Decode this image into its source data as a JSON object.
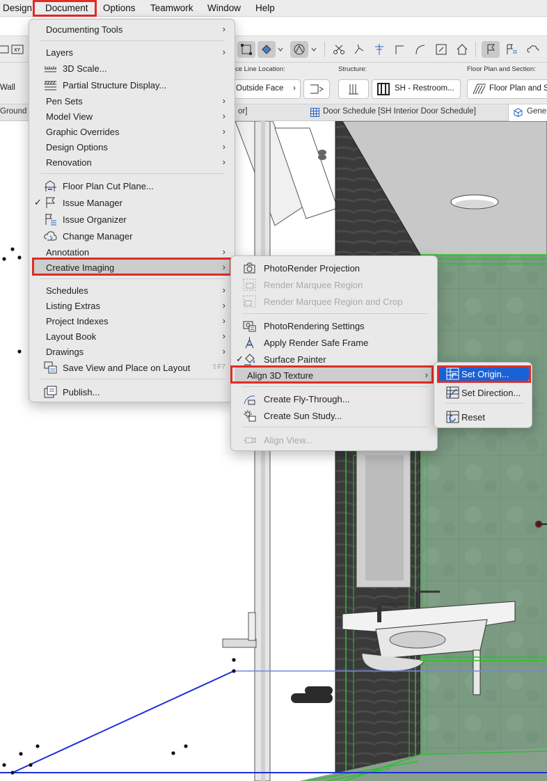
{
  "menubar": {
    "items": [
      "Design",
      "Document",
      "Options",
      "Teamwork",
      "Window",
      "Help"
    ],
    "highlight_color": "#e02c25"
  },
  "infobox": {
    "ref_line_label": "ce Line Location:",
    "ref_line_value": "Outside Face",
    "structure_label": "Structure:",
    "structure_value": "SH - Restroom...",
    "floorplan_label": "Floor Plan and Section:",
    "floorplan_value": "Floor Plan and S",
    "wall_value": "Wall"
  },
  "tabs": {
    "ground": "Ground",
    "partial": "or]",
    "door_schedule": "Door Schedule [SH Interior Door Schedule]",
    "generic": "Gener"
  },
  "document_menu": {
    "items": [
      {
        "label": "Documenting Tools",
        "submenu": true
      },
      {
        "label": "Layers",
        "submenu": true
      },
      {
        "label": "3D Scale...",
        "icon": "3d-scale-icon"
      },
      {
        "label": "Partial Structure Display...",
        "icon": "partial-structure-icon"
      },
      {
        "label": "Pen Sets",
        "submenu": true
      },
      {
        "label": "Model View",
        "submenu": true
      },
      {
        "label": "Graphic Overrides",
        "submenu": true
      },
      {
        "label": "Design Options",
        "submenu": true
      },
      {
        "label": "Renovation",
        "submenu": true
      },
      {
        "label": "Floor Plan Cut Plane...",
        "icon": "cut-plane-icon"
      },
      {
        "label": "Issue Manager",
        "icon": "flag-icon",
        "checked": true
      },
      {
        "label": "Issue Organizer",
        "icon": "issue-organizer-icon"
      },
      {
        "label": "Change Manager",
        "icon": "change-manager-icon"
      },
      {
        "label": "Annotation",
        "submenu": true
      },
      {
        "label": "Creative Imaging",
        "submenu": true,
        "highlighted": true
      },
      {
        "label": "Schedules",
        "submenu": true
      },
      {
        "label": "Listing Extras",
        "submenu": true
      },
      {
        "label": "Project Indexes",
        "submenu": true
      },
      {
        "label": "Layout Book",
        "submenu": true
      },
      {
        "label": "Drawings",
        "submenu": true
      },
      {
        "label": "Save View and Place on Layout",
        "icon": "save-view-icon",
        "shortcut": "⇧F7"
      },
      {
        "label": "Publish...",
        "icon": "publish-icon"
      }
    ]
  },
  "creative_imaging_menu": {
    "items": [
      {
        "label": "PhotoRender Projection",
        "icon": "camera-icon"
      },
      {
        "label": "Render Marquee Region",
        "icon": "marquee-camera-icon",
        "disabled": true
      },
      {
        "label": "Render Marquee Region and Crop",
        "icon": "marquee-crop-icon",
        "disabled": true
      },
      {
        "label": "PhotoRendering Settings",
        "icon": "render-settings-icon"
      },
      {
        "label": "Apply Render Safe Frame",
        "icon": "safe-frame-icon"
      },
      {
        "label": "Surface Painter",
        "icon": "paint-bucket-icon",
        "checked": true
      },
      {
        "label": "Align 3D Texture",
        "submenu": true,
        "highlighted": true
      },
      {
        "label": "Create Fly-Through...",
        "icon": "fly-through-icon"
      },
      {
        "label": "Create Sun Study...",
        "icon": "sun-study-icon"
      },
      {
        "label": "Align View...",
        "icon": "align-view-icon",
        "disabled": true
      }
    ]
  },
  "align_texture_menu": {
    "items": [
      {
        "label": "Set Origin...",
        "icon": "set-origin-icon",
        "selected": true
      },
      {
        "label": "Set Direction...",
        "icon": "set-direction-icon"
      },
      {
        "label": "Reset",
        "icon": "reset-icon"
      }
    ]
  },
  "colors": {
    "menu_bg": "#e9e9e9",
    "selection_blue": "#1a61d6",
    "callout_red": "#e02c25",
    "tile_green": "#7a9a82"
  }
}
